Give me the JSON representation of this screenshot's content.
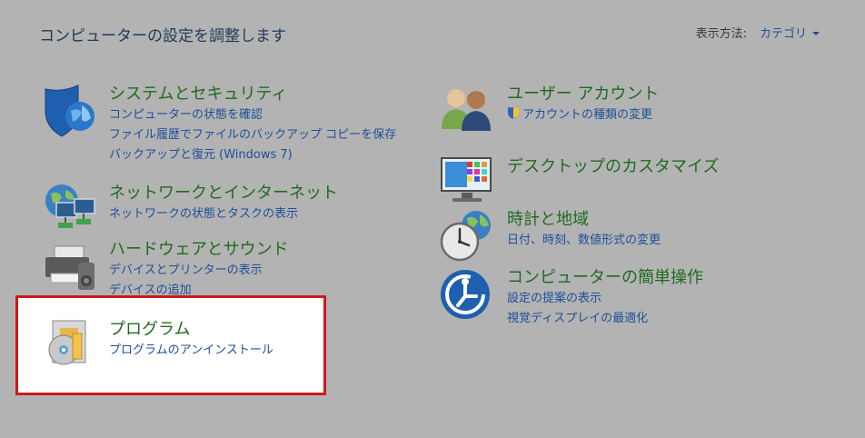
{
  "header": {
    "title": "コンピューターの設定を調整します",
    "view_by_label": "表示方法:",
    "view_by_value": "カテゴリ"
  },
  "left_column": [
    {
      "title": "システムとセキュリティ",
      "icon": "shield-icon",
      "links": [
        "コンピューターの状態を確認",
        "ファイル履歴でファイルのバックアップ コピーを保存",
        "バックアップと復元 (Windows 7)"
      ]
    },
    {
      "title": "ネットワークとインターネット",
      "icon": "network-icon",
      "links": [
        "ネットワークの状態とタスクの表示"
      ]
    },
    {
      "title": "ハードウェアとサウンド",
      "icon": "printer-icon",
      "links": [
        "デバイスとプリンターの表示",
        "デバイスの追加"
      ]
    },
    {
      "title": "プログラム",
      "icon": "programs-icon",
      "links": [
        "プログラムのアンインストール"
      ]
    }
  ],
  "right_column": [
    {
      "title": "ユーザー アカウント",
      "icon": "users-icon",
      "links": [
        "アカウントの種類の変更"
      ]
    },
    {
      "title": "デスクトップのカスタマイズ",
      "icon": "desktop-icon",
      "links": []
    },
    {
      "title": "時計と地域",
      "icon": "clock-globe-icon",
      "links": [
        "日付、時刻、数値形式の変更"
      ]
    },
    {
      "title": "コンピューターの簡単操作",
      "icon": "ease-of-access-icon",
      "links": [
        "設定の提案の表示",
        "視覚ディスプレイの最適化"
      ]
    }
  ],
  "colors": {
    "background": "#b3b3b3",
    "category_title": "#1e6b1e",
    "link": "#1c4f99",
    "highlight_border": "#cc1a1a"
  }
}
